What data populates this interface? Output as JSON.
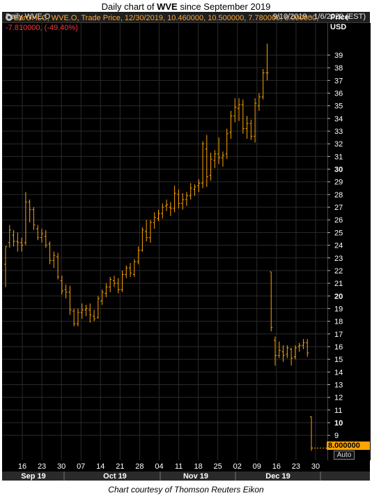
{
  "title": {
    "prefix": "Daily chart of ",
    "ticker": "WVE",
    "suffix": " since September 2019"
  },
  "header": {
    "left": "Daily WVE.O",
    "right": "9/10/2019 - 1/6/2020 (EST)"
  },
  "legend": {
    "line1": "BarOHLC, WVE.O, Trade Price, 12/30/2019, 10.460000, 10.500000, 7.780000, 8.000000,",
    "line2": "-7.810000, (-49.40%)"
  },
  "axis_title": {
    "line1": "Price",
    "line2": "USD"
  },
  "last_price": "8.000000",
  "auto_label": "Auto",
  "caption": "Chart courtesy of Thomson Reuters Eikon",
  "colors": {
    "bars": "#ffa500",
    "background": "#000000",
    "grid": "#2b2b2b",
    "change": "#ff3333"
  },
  "chart_data": {
    "type": "bar",
    "subtype": "ohlc",
    "ylim": [
      7,
      41
    ],
    "ylabel": "Price USD",
    "y_ticks": [
      9,
      10,
      11,
      12,
      13,
      14,
      15,
      16,
      17,
      18,
      19,
      20,
      21,
      22,
      23,
      24,
      25,
      26,
      27,
      28,
      29,
      30,
      31,
      32,
      33,
      34,
      35,
      36,
      37,
      38,
      39
    ],
    "y_ticks_bold": [
      10,
      20,
      30
    ],
    "x_ticks": [
      "16",
      "23",
      "30",
      "07",
      "14",
      "21",
      "28",
      "04",
      "11",
      "18",
      "25",
      "02",
      "09",
      "16",
      "23",
      "30"
    ],
    "months": [
      "Sep 19",
      "Oct 19",
      "Nov 19",
      "Dec 19"
    ],
    "ohlc": [
      [
        22.5,
        23.9,
        20.7,
        23.9
      ],
      [
        24.2,
        25.6,
        23.8,
        25.2
      ],
      [
        24.8,
        25.2,
        23.9,
        24.3
      ],
      [
        24.3,
        25.0,
        23.5,
        24.2
      ],
      [
        24.2,
        24.6,
        23.5,
        24.0
      ],
      [
        24.2,
        28.2,
        24.0,
        27.4
      ],
      [
        27.4,
        27.6,
        25.8,
        26.8
      ],
      [
        26.8,
        27.0,
        25.2,
        25.6
      ],
      [
        25.3,
        25.6,
        24.4,
        24.6
      ],
      [
        24.6,
        25.3,
        24.2,
        24.9
      ],
      [
        24.7,
        25.2,
        23.8,
        24.0
      ],
      [
        24.1,
        24.3,
        22.5,
        22.8
      ],
      [
        22.8,
        23.5,
        22.2,
        23.2
      ],
      [
        23.1,
        23.4,
        21.3,
        21.5
      ],
      [
        21.2,
        21.6,
        20.1,
        20.4
      ],
      [
        20.5,
        20.9,
        19.8,
        20.3
      ],
      [
        20.3,
        20.8,
        18.5,
        18.9
      ],
      [
        18.8,
        19.0,
        17.6,
        17.8
      ],
      [
        17.8,
        19.0,
        17.6,
        18.7
      ],
      [
        18.7,
        19.4,
        18.2,
        18.9
      ],
      [
        18.9,
        19.3,
        18.4,
        19.0
      ],
      [
        18.9,
        19.4,
        17.9,
        18.5
      ],
      [
        18.4,
        18.9,
        18.0,
        18.2
      ],
      [
        18.3,
        20.0,
        18.2,
        19.8
      ],
      [
        19.6,
        20.5,
        19.3,
        20.3
      ],
      [
        20.2,
        21.0,
        19.9,
        20.7
      ],
      [
        20.7,
        21.5,
        20.3,
        21.3
      ],
      [
        21.2,
        21.6,
        20.7,
        21.0
      ],
      [
        21.0,
        21.4,
        20.2,
        20.5
      ],
      [
        20.5,
        22.0,
        20.3,
        21.7
      ],
      [
        21.7,
        22.4,
        21.4,
        22.2
      ],
      [
        22.2,
        22.6,
        21.5,
        21.8
      ],
      [
        21.7,
        22.9,
        21.5,
        22.7
      ],
      [
        22.7,
        23.9,
        22.5,
        23.6
      ],
      [
        23.6,
        25.4,
        23.5,
        25.2
      ],
      [
        25.1,
        26.0,
        24.3,
        24.6
      ],
      [
        24.6,
        26.0,
        24.2,
        25.8
      ],
      [
        25.8,
        26.6,
        25.3,
        26.2
      ],
      [
        26.1,
        26.8,
        25.9,
        26.5
      ],
      [
        26.5,
        27.3,
        26.1,
        27.0
      ],
      [
        27.1,
        27.6,
        26.7,
        27.2
      ],
      [
        27.0,
        27.4,
        26.3,
        26.9
      ],
      [
        26.9,
        28.7,
        26.6,
        28.1
      ],
      [
        28.0,
        28.4,
        26.9,
        27.3
      ],
      [
        27.3,
        28.1,
        26.8,
        27.6
      ],
      [
        27.6,
        28.2,
        27.1,
        27.9
      ],
      [
        27.9,
        28.9,
        27.6,
        28.5
      ],
      [
        28.4,
        28.8,
        27.9,
        28.6
      ],
      [
        28.7,
        29.2,
        28.2,
        28.9
      ],
      [
        28.9,
        32.2,
        28.5,
        32.0
      ],
      [
        31.6,
        32.7,
        28.6,
        29.4
      ],
      [
        29.5,
        31.3,
        29.1,
        30.8
      ],
      [
        30.7,
        31.5,
        30.1,
        31.2
      ],
      [
        31.2,
        32.5,
        30.4,
        30.9
      ],
      [
        30.9,
        31.4,
        30.2,
        31.1
      ],
      [
        31.2,
        33.2,
        30.8,
        32.8
      ],
      [
        32.9,
        34.6,
        32.4,
        34.2
      ],
      [
        34.2,
        35.6,
        33.7,
        34.9
      ],
      [
        34.8,
        35.6,
        33.8,
        35.1
      ],
      [
        35.1,
        35.5,
        32.8,
        33.2
      ],
      [
        33.2,
        34.2,
        32.4,
        33.6
      ],
      [
        33.6,
        33.9,
        32.3,
        32.6
      ],
      [
        32.6,
        35.6,
        32.1,
        35.2
      ],
      [
        35.0,
        36.0,
        34.6,
        35.7
      ],
      [
        35.7,
        37.9,
        35.5,
        37.6
      ],
      [
        37.6,
        39.9,
        37.0,
        37.6
      ],
      [
        21.9,
        21.9,
        17.2,
        17.5
      ],
      [
        16.5,
        16.8,
        14.5,
        15.3
      ],
      [
        15.3,
        16.4,
        15.1,
        15.7
      ],
      [
        15.6,
        16.1,
        14.8,
        15.3
      ],
      [
        15.4,
        16.1,
        15.1,
        15.9
      ],
      [
        15.8,
        15.9,
        14.5,
        15.1
      ],
      [
        15.2,
        16.1,
        15.0,
        15.9
      ],
      [
        16.0,
        16.3,
        15.6,
        16.1
      ],
      [
        16.1,
        16.6,
        15.8,
        16.3
      ],
      [
        16.3,
        16.6,
        15.2,
        15.5
      ],
      [
        10.46,
        10.5,
        7.78,
        8.0
      ]
    ]
  }
}
